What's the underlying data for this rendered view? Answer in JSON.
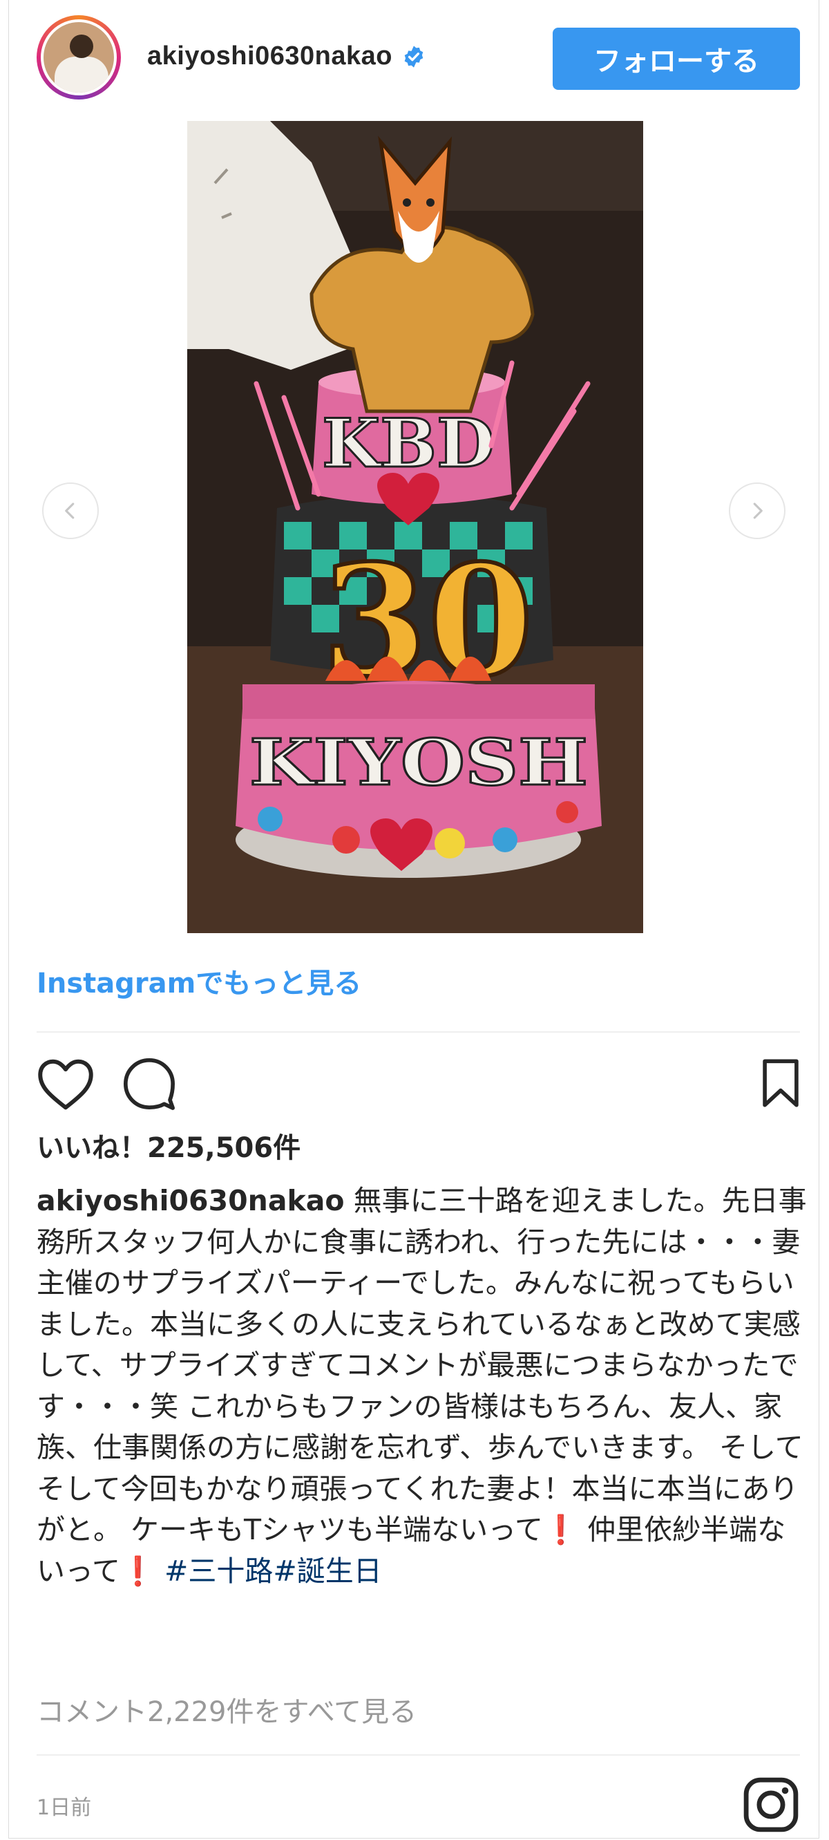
{
  "post": {
    "username": "akiyoshi0630nakao",
    "follow_label": "フォローする",
    "more_link": "Instagramでもっと見る",
    "likes": "いいね！225,506件",
    "caption_user": "akiyoshi0630nakao",
    "caption_text": " 無事に三十路を迎えました。先日事務所スタッフ何人かに食事に誘われ、行った先には・・・妻主催のサプライズパーティーでした。みんなに祝ってもらいました。本当に多くの人に支えられているなぁと改めて実感して、サプライズすぎてコメントが最悪につまらなかったです・・・笑 これからもファンの皆様はもちろん、友人、家族、仕事関係の方に感謝を忘れず、歩んでいきます。 そしてそして今回もかなり頑張ってくれた妻よ！本当に本当にありがと。 ケーキもTシャツも半端ないって",
    "caption_mark": "❗",
    "caption_text2": " 仲里依紗半端ないって",
    "hashtags": " #三十路#誕生日",
    "comments": "コメント2,229件をすべて見る",
    "time": "1日前"
  },
  "photo": {
    "cake_text_top": "KBD",
    "cake_text_number": "30",
    "cake_text_bottom": "KIYOSH"
  },
  "colors": {
    "accent": "#3897f0",
    "hashtag": "#003569",
    "muted": "#999999",
    "mark": "#e0245e"
  },
  "icons": [
    "heart-icon",
    "comment-icon",
    "bookmark-icon",
    "verified-icon",
    "instagram-logo-icon",
    "chevron-left-icon",
    "chevron-right-icon"
  ]
}
